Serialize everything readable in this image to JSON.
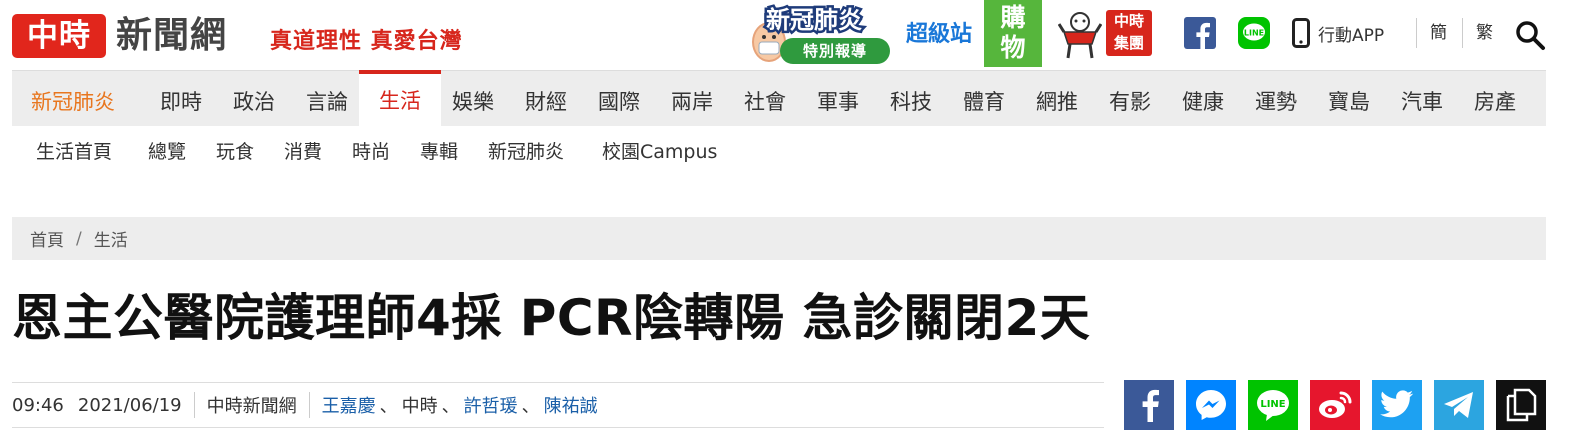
{
  "header": {
    "logo_mark": "中時",
    "logo_text": "新聞網",
    "slogan": "真道理性 真愛台灣",
    "covid_promo": {
      "title": "新冠肺炎",
      "subtitle": "特別報導"
    },
    "super_station": "超級站",
    "shop": [
      "購",
      "物"
    ],
    "group_logo": [
      "中時",
      "集團"
    ],
    "icons": [
      "facebook-icon",
      "line-icon",
      "mobile-icon",
      "search-icon"
    ],
    "app_label": "行動APP",
    "lang_simplified": "簡",
    "lang_traditional": "繁",
    "colors": {
      "brand_red": "#e1261c",
      "facebook": "#3b5998",
      "line": "#00c300",
      "shop_green": "#56b63c"
    }
  },
  "mainnav": {
    "items": [
      "新冠肺炎",
      "即時",
      "政治",
      "言論",
      "生活",
      "娛樂",
      "財經",
      "國際",
      "兩岸",
      "社會",
      "軍事",
      "科技",
      "體育",
      "網推",
      "有影",
      "健康",
      "運勢",
      "寶島",
      "汽車",
      "房產"
    ],
    "active": "生活",
    "highlight": "新冠肺炎"
  },
  "subnav": {
    "items": [
      "生活首頁",
      "總覽",
      "玩食",
      "消費",
      "時尚",
      "專輯",
      "新冠肺炎",
      "校園Campus"
    ]
  },
  "breadcrumb": {
    "home": "首頁",
    "separator": "/",
    "current": "生活"
  },
  "article": {
    "headline": "恩主公醫院護理師4採 PCR陰轉陽 急診關閉2天",
    "time": "09:46",
    "date": "2021/06/19",
    "source": "中時新聞網",
    "authors": [
      "王嘉慶",
      "中時",
      "許哲瑗",
      "陳祐誠"
    ],
    "author_separator": "、"
  },
  "share": {
    "buttons": [
      {
        "name": "facebook",
        "color": "#3b5998"
      },
      {
        "name": "messenger",
        "color": "#0084ff"
      },
      {
        "name": "line",
        "color": "#00c300"
      },
      {
        "name": "weibo",
        "color": "#e6162d"
      },
      {
        "name": "twitter",
        "color": "#1da1f2"
      },
      {
        "name": "telegram",
        "color": "#2ca5e0"
      },
      {
        "name": "copy",
        "color": "#111111"
      }
    ]
  }
}
